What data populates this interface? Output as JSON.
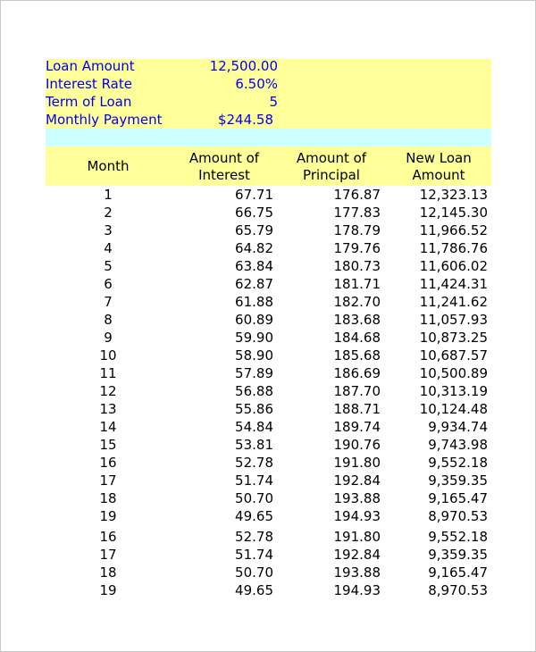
{
  "summary": {
    "items": [
      {
        "label": "Loan Amount",
        "value": "12,500.00"
      },
      {
        "label": "Interest Rate",
        "value": "6.50%"
      },
      {
        "label": "Term of Loan",
        "value": "5"
      },
      {
        "label": "Monthly Payment",
        "value": "$244.58"
      }
    ]
  },
  "colors": {
    "summary_bg": "#ffff99",
    "band_bg": "#ccffff",
    "label_text": "#0000ee"
  },
  "table": {
    "headers": {
      "month": "Month",
      "interest_line1": "Amount of",
      "interest_line2": "Interest",
      "principal_line1": "Amount of",
      "principal_line2": "Principal",
      "new_line1": "New Loan",
      "new_line2": "Amount"
    },
    "rows": [
      {
        "month": "1",
        "interest": "67.71",
        "principal": "176.87",
        "new_amount": "12,323.13"
      },
      {
        "month": "2",
        "interest": "66.75",
        "principal": "177.83",
        "new_amount": "12,145.30"
      },
      {
        "month": "3",
        "interest": "65.79",
        "principal": "178.79",
        "new_amount": "11,966.52"
      },
      {
        "month": "4",
        "interest": "64.82",
        "principal": "179.76",
        "new_amount": "11,786.76"
      },
      {
        "month": "5",
        "interest": "63.84",
        "principal": "180.73",
        "new_amount": "11,606.02"
      },
      {
        "month": "6",
        "interest": "62.87",
        "principal": "181.71",
        "new_amount": "11,424.31"
      },
      {
        "month": "7",
        "interest": "61.88",
        "principal": "182.70",
        "new_amount": "11,241.62"
      },
      {
        "month": "8",
        "interest": "60.89",
        "principal": "183.68",
        "new_amount": "11,057.93"
      },
      {
        "month": "9",
        "interest": "59.90",
        "principal": "184.68",
        "new_amount": "10,873.25"
      },
      {
        "month": "10",
        "interest": "58.90",
        "principal": "185.68",
        "new_amount": "10,687.57"
      },
      {
        "month": "11",
        "interest": "57.89",
        "principal": "186.69",
        "new_amount": "10,500.89"
      },
      {
        "month": "12",
        "interest": "56.88",
        "principal": "187.70",
        "new_amount": "10,313.19"
      },
      {
        "month": "13",
        "interest": "55.86",
        "principal": "188.71",
        "new_amount": "10,124.48"
      },
      {
        "month": "14",
        "interest": "54.84",
        "principal": "189.74",
        "new_amount": "9,934.74"
      },
      {
        "month": "15",
        "interest": "53.81",
        "principal": "190.76",
        "new_amount": "9,743.98"
      },
      {
        "month": "16",
        "interest": "52.78",
        "principal": "191.80",
        "new_amount": "9,552.18"
      },
      {
        "month": "17",
        "interest": "51.74",
        "principal": "192.84",
        "new_amount": "9,359.35"
      },
      {
        "month": "18",
        "interest": "50.70",
        "principal": "193.88",
        "new_amount": "9,165.47"
      },
      {
        "month": "19",
        "interest": "49.65",
        "principal": "194.93",
        "new_amount": "8,970.53"
      },
      {
        "month": "16",
        "interest": "52.78",
        "principal": "191.80",
        "new_amount": "9,552.18"
      },
      {
        "month": "17",
        "interest": "51.74",
        "principal": "192.84",
        "new_amount": "9,359.35"
      },
      {
        "month": "18",
        "interest": "50.70",
        "principal": "193.88",
        "new_amount": "9,165.47"
      },
      {
        "month": "19",
        "interest": "49.65",
        "principal": "194.93",
        "new_amount": "8,970.53"
      }
    ]
  }
}
